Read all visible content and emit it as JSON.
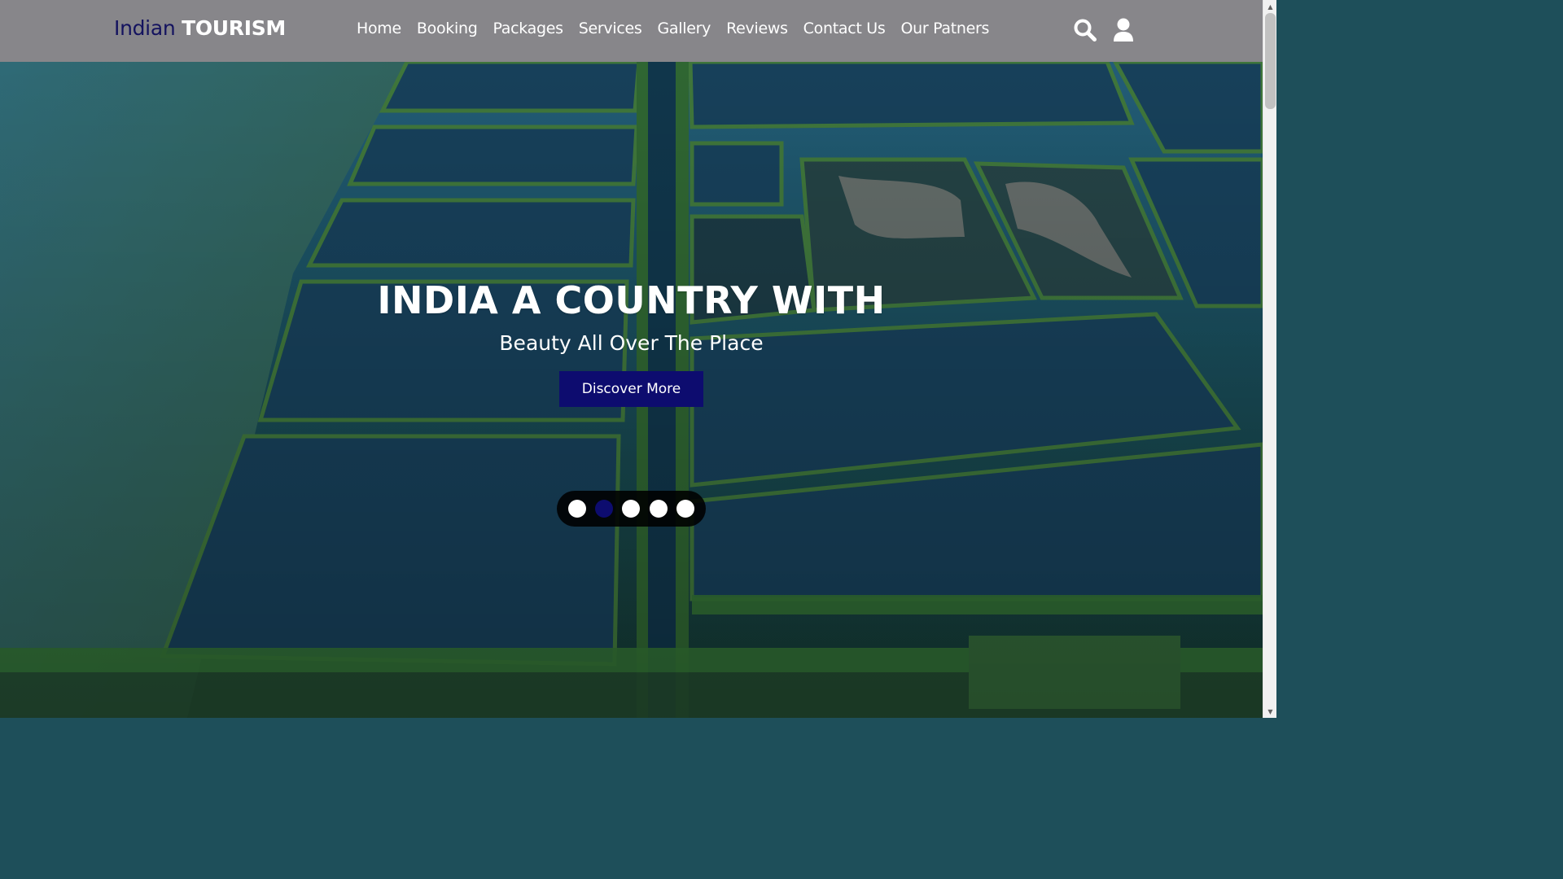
{
  "header": {
    "logo_primary": "Indian",
    "logo_secondary": "TOURISM",
    "nav": [
      {
        "label": "Home"
      },
      {
        "label": "Booking"
      },
      {
        "label": "Packages"
      },
      {
        "label": "Services"
      },
      {
        "label": "Gallery"
      },
      {
        "label": "Reviews"
      },
      {
        "label": "Contact Us"
      },
      {
        "label": "Our Patners"
      }
    ],
    "icons": [
      "search-icon",
      "user-icon"
    ]
  },
  "hero": {
    "title": "INDIA A COUNTRY WITH",
    "subtitle": "Beauty All Over The Place",
    "cta_label": "Discover More",
    "slider_dot_count": 5,
    "active_slide_index": 1
  },
  "colors": {
    "header_bg": "#87868a",
    "brand_dark": "#14135f",
    "accent": "#0d0c6f",
    "text_light": "#ffffff"
  }
}
